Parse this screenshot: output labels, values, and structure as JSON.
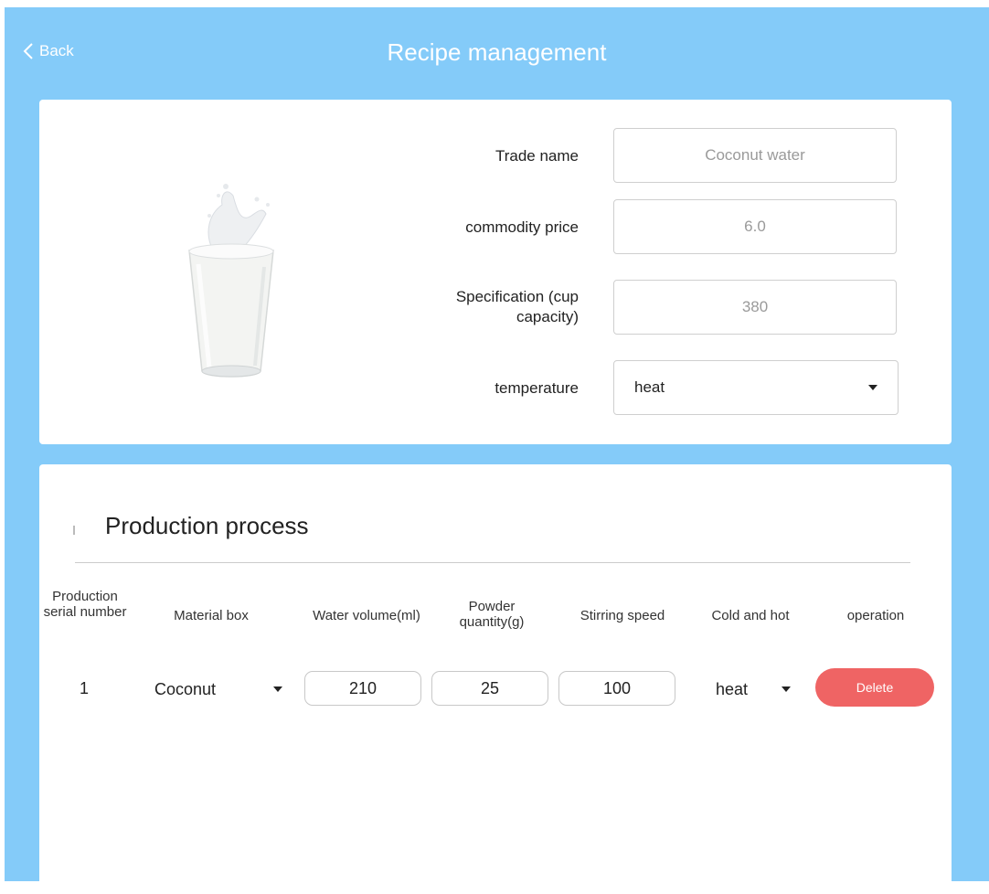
{
  "header": {
    "back_label": "Back",
    "title": "Recipe management"
  },
  "product": {
    "image_icon": "milk-glass-icon",
    "fields": {
      "trade_name": {
        "label": "Trade name",
        "value": "Coconut water"
      },
      "price": {
        "label": "commodity price",
        "value": "6.0"
      },
      "spec": {
        "label": "Specification (cup capacity)",
        "value": "380"
      },
      "temperature": {
        "label": "temperature",
        "value": "heat"
      }
    }
  },
  "process": {
    "title": "Production process",
    "columns": [
      "Production serial number",
      "Material box",
      "Water volume(ml)",
      "Powder quantity(g)",
      "Stirring speed",
      "Cold and hot",
      "operation"
    ],
    "rows": [
      {
        "serial": "1",
        "material": "Coconut",
        "water": "210",
        "powder": "25",
        "speed": "100",
        "temp": "heat",
        "action": "Delete"
      }
    ]
  },
  "colors": {
    "background": "#84cbf9",
    "delete_button": "#ef6464"
  }
}
